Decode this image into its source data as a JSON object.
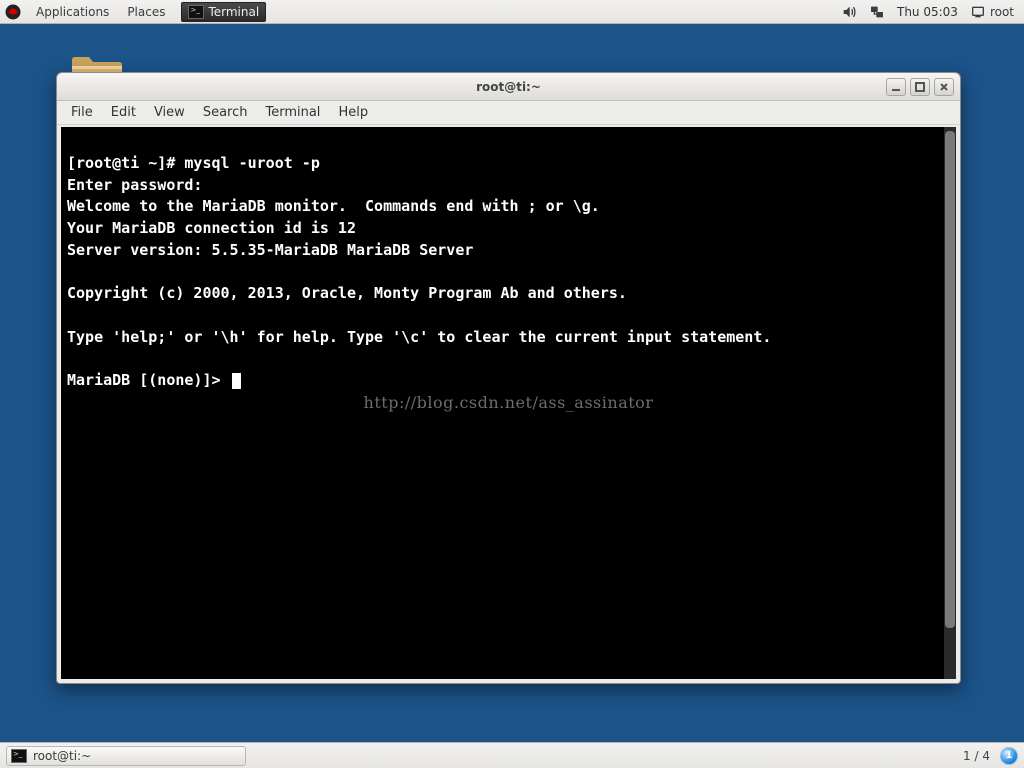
{
  "top_panel": {
    "menu": {
      "applications": "Applications",
      "places": "Places"
    },
    "active_app": "Terminal",
    "clock": "Thu 05:03",
    "user": "root"
  },
  "window": {
    "title": "root@ti:~",
    "menubar": {
      "file": "File",
      "edit": "Edit",
      "view": "View",
      "search": "Search",
      "terminal": "Terminal",
      "help": "Help"
    }
  },
  "terminal": {
    "lines": [
      "[root@ti ~]# mysql -uroot -p",
      "Enter password: ",
      "Welcome to the MariaDB monitor.  Commands end with ; or \\g.",
      "Your MariaDB connection id is 12",
      "Server version: 5.5.35-MariaDB MariaDB Server",
      "",
      "Copyright (c) 2000, 2013, Oracle, Monty Program Ab and others.",
      "",
      "Type 'help;' or '\\h' for help. Type '\\c' to clear the current input statement.",
      ""
    ],
    "prompt": "MariaDB [(none)]> ",
    "watermark": "http://blog.csdn.net/ass_assinator"
  },
  "bottom_panel": {
    "task_label": "root@ti:~",
    "workspace": "1 / 4",
    "notification_count": "1"
  }
}
